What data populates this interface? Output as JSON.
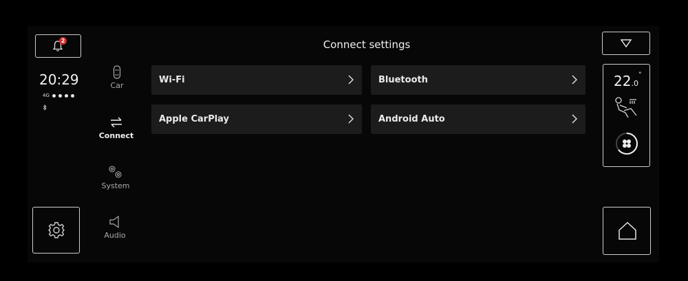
{
  "status": {
    "notification_count": "2",
    "time": "20:29",
    "network": "4G"
  },
  "nav": {
    "items": [
      {
        "label": "Car",
        "icon": "car-icon"
      },
      {
        "label": "Connect",
        "icon": "swap-arrows-icon",
        "active": true
      },
      {
        "label": "System",
        "icon": "gears-icon"
      },
      {
        "label": "Audio",
        "icon": "speaker-icon"
      }
    ]
  },
  "header": {
    "title": "Connect settings"
  },
  "tiles": [
    {
      "label": "Wi-Fi"
    },
    {
      "label": "Bluetooth"
    },
    {
      "label": "Apple CarPlay"
    },
    {
      "label": "Android Auto"
    }
  ],
  "climate": {
    "temp_whole": "22",
    "temp_decimal": ".0",
    "temp_unit": "°"
  },
  "icons": {
    "notification": "bell-icon",
    "settings": "gear-icon",
    "dropdown": "triangle-down-icon",
    "seat": "seat-heat-icon",
    "fan": "fan-icon",
    "home": "home-icon"
  }
}
